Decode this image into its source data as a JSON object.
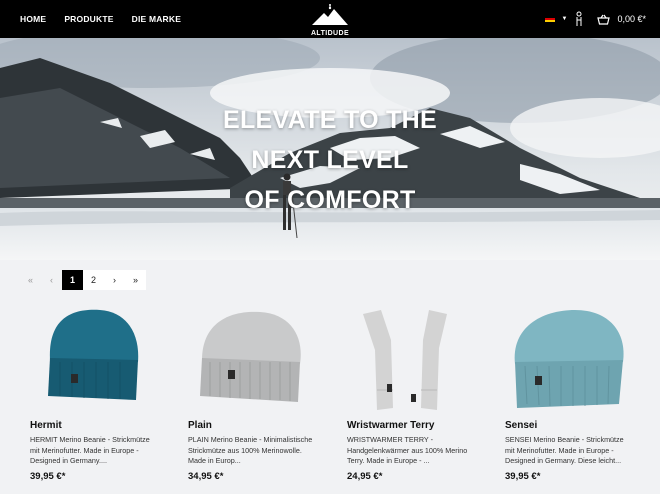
{
  "header": {
    "nav": [
      "HOME",
      "PRODUKTE",
      "DIE MARKE"
    ],
    "logo_text": "ALTIDUDE",
    "cart_total": "0,00 €*"
  },
  "hero": {
    "title_lines": [
      "ELEVATE TO THE",
      "NEXT LEVEL",
      "OF COMFORT"
    ]
  },
  "pagination": {
    "first": "«",
    "prev": "‹",
    "pages": [
      "1",
      "2"
    ],
    "current": "1",
    "next": "›",
    "last": "»"
  },
  "products": [
    {
      "name": "Hermit",
      "description": "HERMIT Merino Beanie - Strickmütze mit Merinofutter. Made in Europe - Designed in Germany....",
      "price": "39,95 €*",
      "color": "#1f6f89"
    },
    {
      "name": "Plain",
      "description": "PLAIN Merino Beanie - Minimalistische Strickmütze aus 100% Merinowolle. Made in Europ...",
      "price": "34,95 €*",
      "color": "#c9cacb"
    },
    {
      "name": "Wristwarmer Terry",
      "description": "WRISTWARMER TERRY - Handgelenkwärmer aus 100% Merino Terry. Made in Europe - ...",
      "price": "24,95 €*",
      "color": "#d3d3d3"
    },
    {
      "name": "Sensei",
      "description": "SENSEI Merino Beanie - Strickmütze mit Merinofutter. Made in Europe - Designed in Germany. Diese leicht...",
      "price": "39,95 €*",
      "color": "#7fb6c2"
    }
  ]
}
